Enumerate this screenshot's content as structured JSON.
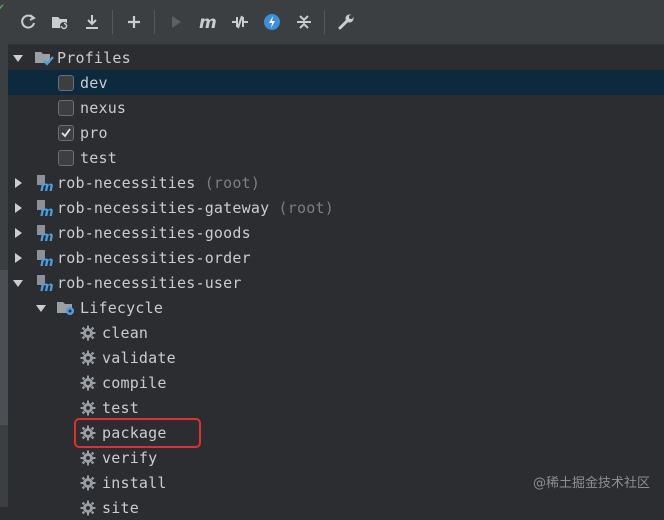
{
  "toolbar": {
    "icons": [
      "reload-icon",
      "add-folder-icon",
      "download-icon",
      "add-icon",
      "run-icon",
      "execute-maven-goal-icon",
      "toggle-offline-icon",
      "skip-tests-icon",
      "collapse-all-icon",
      "settings-icon"
    ]
  },
  "tree": {
    "profiles": {
      "label": "Profiles",
      "items": [
        {
          "label": "dev",
          "checked": false,
          "selected": true
        },
        {
          "label": "nexus",
          "checked": false,
          "selected": false
        },
        {
          "label": "pro",
          "checked": true,
          "selected": false
        },
        {
          "label": "test",
          "checked": false,
          "selected": false
        }
      ]
    },
    "modules": [
      {
        "label": "rob-necessities",
        "suffix": "(root)",
        "expanded": false
      },
      {
        "label": "rob-necessities-gateway",
        "suffix": "(root)",
        "expanded": false
      },
      {
        "label": "rob-necessities-goods",
        "suffix": "",
        "expanded": false
      },
      {
        "label": "rob-necessities-order",
        "suffix": "",
        "expanded": false
      },
      {
        "label": "rob-necessities-user",
        "suffix": "",
        "expanded": true
      }
    ],
    "lifecycle": {
      "label": "Lifecycle",
      "goals": [
        "clean",
        "validate",
        "compile",
        "test",
        "package",
        "verify",
        "install",
        "site"
      ]
    }
  },
  "highlighted_goal": "package",
  "watermark": "@稀土掘金技术社区",
  "colors": {
    "background": "#2b2d30",
    "toolbar": "#3c3f41",
    "selection": "#0d293e",
    "highlight_box": "#e02f2f",
    "maven_icon": "#4a9fe0"
  }
}
